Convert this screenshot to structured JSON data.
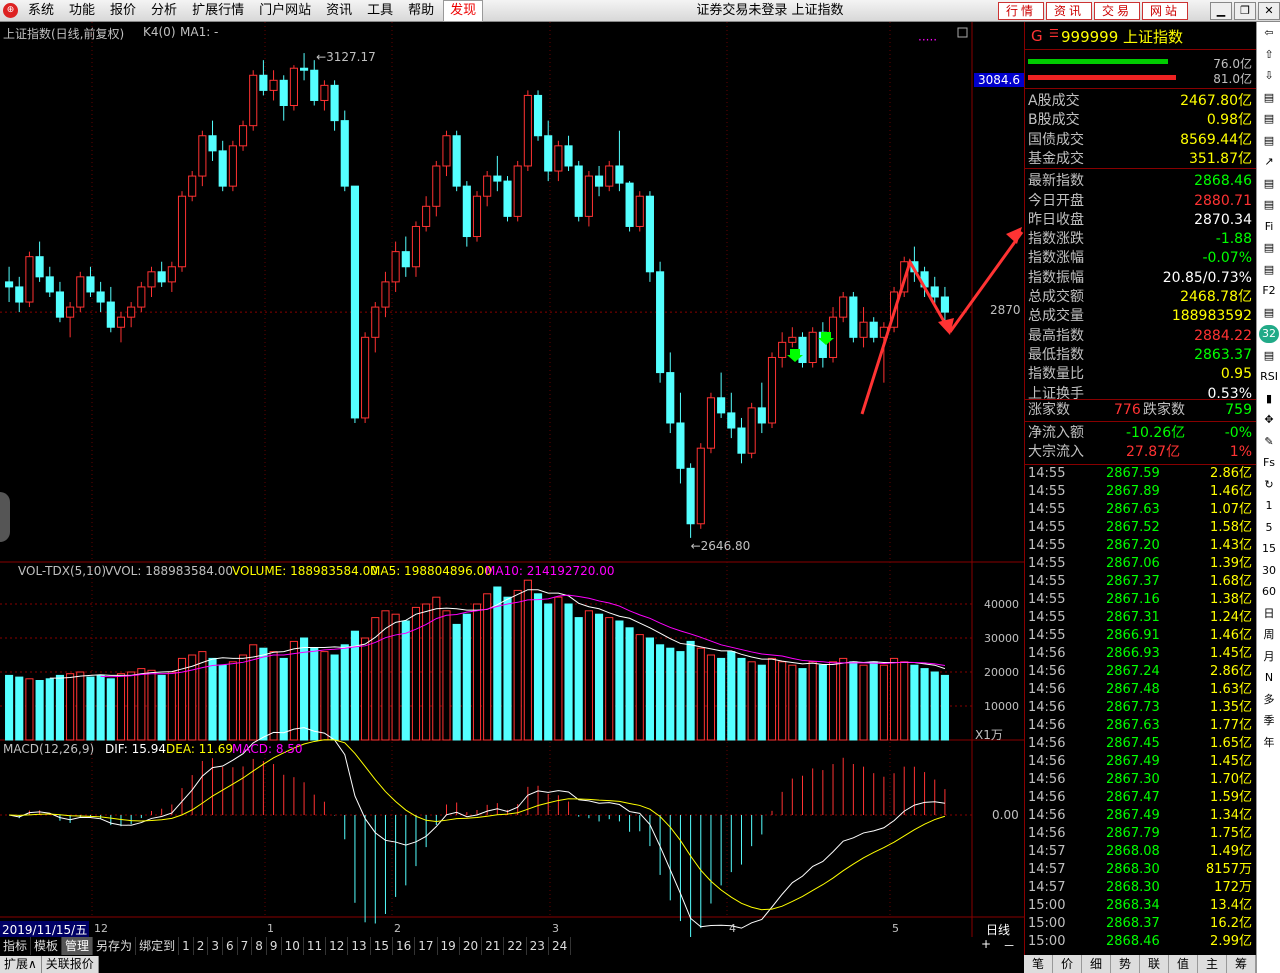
{
  "menu": {
    "items": [
      "系统",
      "功能",
      "报价",
      "分析",
      "扩展行情",
      "门户网站",
      "资讯",
      "工具",
      "帮助",
      "发现"
    ],
    "title": "证券交易未登录 上证指数",
    "tabs": [
      "行情",
      "资讯",
      "交易",
      "网站"
    ]
  },
  "chart": {
    "title": "上证指数(日线,前复权)",
    "indicator": "K4(0)",
    "ma": "MA1: -",
    "high_label": "3127.17",
    "low_label": "2646.80",
    "price_tag": "3084.6",
    "price_level": "2870",
    "vol_header": {
      "name": "VOL-TDX(5,10)",
      "vvol": "VVOL: 188983584.00",
      "volume": "VOLUME: 188983584.00",
      "ma5": "MA5: 198804896.00",
      "ma10": "MA10: 214192720.00"
    },
    "vol_ticks": [
      "40000",
      "30000",
      "20000",
      "10000"
    ],
    "vol_unit": "X1万",
    "macd_header": {
      "name": "MACD(12,26,9)",
      "dif": "DIF: 15.94",
      "dea": "DEA: 11.69",
      "macd": "MACD: 8.50"
    },
    "macd_zero": "0.00",
    "date_label": "2019/11/15/五",
    "month_labels": [
      "12",
      "1",
      "2",
      "3",
      "4",
      "5"
    ],
    "period": "日线",
    "colors": {
      "up": "#ff3232",
      "down": "#54ffff",
      "ma5": "#ffffff",
      "ma10": "#ff00ff",
      "dif": "#ffffff",
      "dea": "#ffff00"
    }
  },
  "chart_data": {
    "type": "candlestick",
    "ohlc": [
      [
        2900,
        2915,
        2880,
        2895
      ],
      [
        2895,
        2905,
        2870,
        2880
      ],
      [
        2880,
        2930,
        2875,
        2925
      ],
      [
        2925,
        2940,
        2900,
        2905
      ],
      [
        2905,
        2915,
        2885,
        2890
      ],
      [
        2890,
        2900,
        2860,
        2865
      ],
      [
        2865,
        2880,
        2845,
        2875
      ],
      [
        2875,
        2910,
        2870,
        2905
      ],
      [
        2905,
        2915,
        2885,
        2890
      ],
      [
        2890,
        2900,
        2870,
        2880
      ],
      [
        2880,
        2895,
        2850,
        2855
      ],
      [
        2855,
        2870,
        2840,
        2865
      ],
      [
        2865,
        2880,
        2855,
        2875
      ],
      [
        2875,
        2900,
        2870,
        2895
      ],
      [
        2895,
        2915,
        2885,
        2910
      ],
      [
        2910,
        2920,
        2895,
        2900
      ],
      [
        2900,
        2920,
        2890,
        2915
      ],
      [
        2915,
        2990,
        2910,
        2985
      ],
      [
        2985,
        3010,
        2980,
        3005
      ],
      [
        3005,
        3050,
        2995,
        3045
      ],
      [
        3045,
        3060,
        3020,
        3030
      ],
      [
        3030,
        3040,
        2990,
        2995
      ],
      [
        2995,
        3040,
        2990,
        3035
      ],
      [
        3035,
        3060,
        3030,
        3055
      ],
      [
        3055,
        3110,
        3050,
        3105
      ],
      [
        3105,
        3120,
        3085,
        3090
      ],
      [
        3090,
        3110,
        3080,
        3100
      ],
      [
        3100,
        3105,
        3060,
        3075
      ],
      [
        3075,
        3115,
        3070,
        3112
      ],
      [
        3112,
        3127,
        3100,
        3110
      ],
      [
        3110,
        3120,
        3075,
        3080
      ],
      [
        3080,
        3100,
        3070,
        3095
      ],
      [
        3095,
        3100,
        3050,
        3060
      ],
      [
        3060,
        3070,
        2990,
        2995
      ],
      [
        2995,
        2995,
        2760,
        2765
      ],
      [
        2765,
        2850,
        2760,
        2845
      ],
      [
        2845,
        2880,
        2830,
        2875
      ],
      [
        2875,
        2910,
        2865,
        2900
      ],
      [
        2900,
        2940,
        2890,
        2930
      ],
      [
        2930,
        2945,
        2905,
        2915
      ],
      [
        2915,
        2960,
        2905,
        2955
      ],
      [
        2955,
        2985,
        2950,
        2975
      ],
      [
        2975,
        3020,
        2965,
        3015
      ],
      [
        3015,
        3050,
        3005,
        3045
      ],
      [
        3045,
        3050,
        2990,
        2995
      ],
      [
        2995,
        3000,
        2935,
        2945
      ],
      [
        2945,
        2990,
        2940,
        2985
      ],
      [
        2985,
        3010,
        2975,
        3005
      ],
      [
        3005,
        3025,
        2990,
        3000
      ],
      [
        3000,
        3005,
        2960,
        2965
      ],
      [
        2965,
        3020,
        2960,
        3015
      ],
      [
        3015,
        3090,
        3010,
        3085
      ],
      [
        3085,
        3090,
        3040,
        3045
      ],
      [
        3045,
        3060,
        3000,
        3010
      ],
      [
        3010,
        3040,
        3000,
        3035
      ],
      [
        3035,
        3045,
        3010,
        3015
      ],
      [
        3015,
        3020,
        2960,
        2965
      ],
      [
        2965,
        3010,
        2955,
        3005
      ],
      [
        3005,
        3015,
        2985,
        2995
      ],
      [
        2995,
        3020,
        2990,
        3015
      ],
      [
        3015,
        3050,
        2990,
        2998
      ],
      [
        2998,
        3000,
        2950,
        2955
      ],
      [
        2955,
        2990,
        2950,
        2985
      ],
      [
        2985,
        2990,
        2900,
        2910
      ],
      [
        2910,
        2920,
        2800,
        2810
      ],
      [
        2810,
        2830,
        2750,
        2760
      ],
      [
        2760,
        2790,
        2700,
        2715
      ],
      [
        2715,
        2720,
        2646,
        2660
      ],
      [
        2660,
        2740,
        2655,
        2735
      ],
      [
        2735,
        2790,
        2730,
        2785
      ],
      [
        2785,
        2810,
        2765,
        2770
      ],
      [
        2770,
        2790,
        2745,
        2755
      ],
      [
        2755,
        2765,
        2720,
        2730
      ],
      [
        2730,
        2780,
        2725,
        2775
      ],
      [
        2775,
        2800,
        2750,
        2760
      ],
      [
        2760,
        2830,
        2755,
        2825
      ],
      [
        2825,
        2850,
        2815,
        2840
      ],
      [
        2840,
        2855,
        2835,
        2845
      ],
      [
        2845,
        2850,
        2815,
        2820
      ],
      [
        2820,
        2855,
        2815,
        2850
      ],
      [
        2850,
        2860,
        2815,
        2825
      ],
      [
        2825,
        2875,
        2820,
        2865
      ],
      [
        2865,
        2890,
        2860,
        2885
      ],
      [
        2885,
        2890,
        2840,
        2845
      ],
      [
        2845,
        2875,
        2835,
        2860
      ],
      [
        2860,
        2865,
        2840,
        2845
      ],
      [
        2845,
        2860,
        2800,
        2855
      ],
      [
        2855,
        2895,
        2850,
        2890
      ],
      [
        2890,
        2925,
        2885,
        2920
      ],
      [
        2920,
        2935,
        2900,
        2910
      ],
      [
        2910,
        2915,
        2885,
        2895
      ],
      [
        2895,
        2905,
        2875,
        2885
      ],
      [
        2885,
        2895,
        2860,
        2870
      ]
    ],
    "volume": [
      19000,
      18500,
      18000,
      17500,
      18000,
      19000,
      19500,
      20000,
      18500,
      19000,
      18000,
      19500,
      20000,
      21000,
      20500,
      19000,
      20000,
      24000,
      25000,
      26000,
      24000,
      22000,
      23000,
      25000,
      28000,
      27000,
      26000,
      24000,
      29000,
      30000,
      27000,
      26000,
      25000,
      28000,
      32000,
      30000,
      36000,
      38000,
      37000,
      35000,
      39000,
      40000,
      42000,
      38000,
      34000,
      37000,
      40000,
      43000,
      45000,
      42000,
      44000,
      47000,
      43000,
      40000,
      42000,
      40000,
      36000,
      38000,
      37000,
      36000,
      35000,
      33000,
      31000,
      30000,
      28000,
      27000,
      26000,
      29000,
      27000,
      25000,
      24000,
      26000,
      24000,
      23000,
      22000,
      24000,
      23000,
      22000,
      21000,
      23000,
      22000,
      23000,
      24000,
      23000,
      22000,
      23000,
      22000,
      24000,
      23000,
      22000,
      21000,
      20000,
      19000
    ],
    "ylim": [
      2630,
      3140
    ],
    "vol_ylim": [
      0,
      45000
    ],
    "macd_ylim": [
      -60,
      30
    ]
  },
  "quote": {
    "code_prefix": "G",
    "code": "999999 上证指数",
    "bar_vals": [
      "76.0亿",
      "81.0亿"
    ],
    "rows": [
      {
        "k": "A股成交",
        "v": "2467.80亿",
        "c": "#ff0"
      },
      {
        "k": "B股成交",
        "v": "0.98亿",
        "c": "#ff0"
      },
      {
        "k": "国债成交",
        "v": "8569.44亿",
        "c": "#ff0"
      },
      {
        "k": "基金成交",
        "v": "351.87亿",
        "c": "#ff0"
      },
      {
        "k": "最新指数",
        "v": "2868.46",
        "c": "#0f0"
      },
      {
        "k": "今日开盘",
        "v": "2880.71",
        "c": "#f33"
      },
      {
        "k": "昨日收盘",
        "v": "2870.34",
        "c": "#fff"
      },
      {
        "k": "指数涨跌",
        "v": "-1.88",
        "c": "#0f0"
      },
      {
        "k": "指数涨幅",
        "v": "-0.07%",
        "c": "#0f0"
      },
      {
        "k": "指数振幅",
        "v": "20.85/0.73%",
        "c": "#fff"
      },
      {
        "k": "总成交额",
        "v": "2468.78亿",
        "c": "#ff0"
      },
      {
        "k": "总成交量",
        "v": "188983592",
        "c": "#ff0"
      },
      {
        "k": "最高指数",
        "v": "2884.22",
        "c": "#f33"
      },
      {
        "k": "最低指数",
        "v": "2863.37",
        "c": "#0f0"
      },
      {
        "k": "指数量比",
        "v": "0.95",
        "c": "#ff0"
      },
      {
        "k": "上证换手",
        "v": "0.53%",
        "c": "#fff"
      }
    ],
    "up_label": "涨家数",
    "up_count": "776",
    "down_label": "跌家数",
    "down_count": "759",
    "flow": [
      {
        "k": "净流入额",
        "v": "-10.26亿",
        "p": "-0%",
        "c": "#0f0"
      },
      {
        "k": "大宗流入",
        "v": "27.87亿",
        "p": "1%",
        "c": "#f33"
      }
    ],
    "ticks": [
      [
        "14:55",
        "2867.59",
        "2.86亿"
      ],
      [
        "14:55",
        "2867.89",
        "1.46亿"
      ],
      [
        "14:55",
        "2867.63",
        "1.07亿"
      ],
      [
        "14:55",
        "2867.52",
        "1.58亿"
      ],
      [
        "14:55",
        "2867.20",
        "1.43亿"
      ],
      [
        "14:55",
        "2867.06",
        "1.39亿"
      ],
      [
        "14:55",
        "2867.37",
        "1.68亿"
      ],
      [
        "14:55",
        "2867.16",
        "1.38亿"
      ],
      [
        "14:55",
        "2867.31",
        "1.24亿"
      ],
      [
        "14:55",
        "2866.91",
        "1.46亿"
      ],
      [
        "14:56",
        "2866.93",
        "1.45亿"
      ],
      [
        "14:56",
        "2867.24",
        "2.86亿"
      ],
      [
        "14:56",
        "2867.48",
        "1.63亿"
      ],
      [
        "14:56",
        "2867.73",
        "1.35亿"
      ],
      [
        "14:56",
        "2867.63",
        "1.77亿"
      ],
      [
        "14:56",
        "2867.45",
        "1.65亿"
      ],
      [
        "14:56",
        "2867.49",
        "1.45亿"
      ],
      [
        "14:56",
        "2867.30",
        "1.70亿"
      ],
      [
        "14:56",
        "2867.47",
        "1.59亿"
      ],
      [
        "14:56",
        "2867.49",
        "1.34亿"
      ],
      [
        "14:56",
        "2867.79",
        "1.75亿"
      ],
      [
        "14:57",
        "2868.08",
        "1.49亿"
      ],
      [
        "14:57",
        "2868.30",
        "8157万"
      ],
      [
        "14:57",
        "2868.30",
        "172万"
      ],
      [
        "15:00",
        "2868.34",
        "13.4亿"
      ],
      [
        "15:00",
        "2868.37",
        "16.2亿"
      ],
      [
        "15:00",
        "2868.46",
        "2.99亿"
      ]
    ],
    "bottom_tabs": [
      "笔",
      "价",
      "细",
      "势",
      "联",
      "值",
      "主",
      "筹"
    ]
  },
  "bottom": {
    "row1": [
      "指标",
      "模板",
      "管理",
      "另存为",
      "绑定到",
      "1",
      "2",
      "3",
      "6",
      "7",
      "8",
      "9",
      "10",
      "11",
      "12",
      "13",
      "15",
      "16",
      "17",
      "19",
      "20",
      "21",
      "22",
      "23",
      "24"
    ],
    "row2": [
      "扩展∧",
      "关联报价"
    ],
    "right_controls": [
      "+",
      "－"
    ]
  },
  "side_tools": [
    "⇦",
    "⇧",
    "⇩",
    "▤",
    "▤",
    "▤",
    "↗",
    "▤",
    "▤",
    "Fi",
    "▤",
    "▤",
    "F2",
    "▤",
    "32",
    "▤",
    "RSI",
    "▮",
    "✥",
    "✎",
    "Fs",
    "↻",
    "1",
    "5",
    "15",
    "30",
    "60",
    "日",
    "周",
    "月",
    "N",
    "多",
    "季",
    "年"
  ]
}
